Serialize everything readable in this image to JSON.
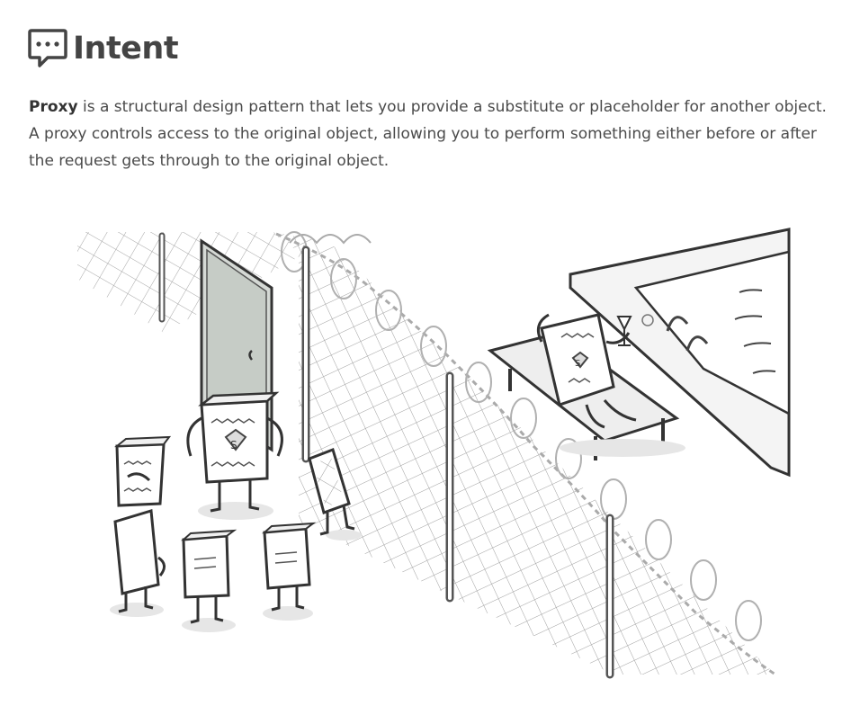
{
  "section": {
    "title": "Intent",
    "icon": "speech-bubble-icon"
  },
  "intro": {
    "term": "Proxy",
    "text": " is a structural design pattern that lets you provide a substitute or placeholder for another object. A proxy controls access to the original object, allowing you to perform something either before or after the request gets through to the original object."
  },
  "illustration": {
    "icon": "proxy-illustration"
  }
}
